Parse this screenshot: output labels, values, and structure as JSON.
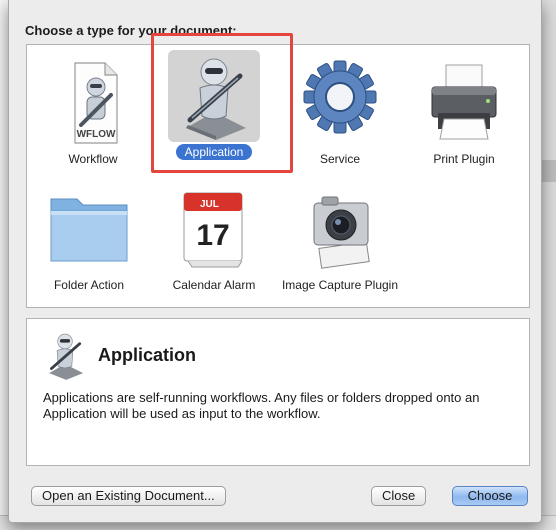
{
  "dialog": {
    "title": "Choose a type for your document:",
    "types": [
      {
        "label": "Workflow",
        "icon": "workflow-document-icon",
        "badge": "WFLOW"
      },
      {
        "label": "Application",
        "icon": "automator-application-icon",
        "selected": true
      },
      {
        "label": "Service",
        "icon": "service-gear-icon"
      },
      {
        "label": "Print Plugin",
        "icon": "printer-icon"
      },
      {
        "label": "Folder Action",
        "icon": "folder-icon"
      },
      {
        "label": "Calendar Alarm",
        "icon": "calendar-icon",
        "month": "JUL",
        "day": "17"
      },
      {
        "label": "Image Capture Plugin",
        "icon": "camera-icon"
      }
    ],
    "description": {
      "title": "Application",
      "text": "Applications are self-running workflows. Any files or folders dropped onto an Application will be used as input to the workflow."
    },
    "buttons": {
      "open_existing": "Open an Existing Document...",
      "close": "Close",
      "choose": "Choose"
    },
    "colors": {
      "selection_blue": "#3b73d1",
      "highlight_red": "#e4463d",
      "default_button": "#8fb8ee"
    }
  }
}
